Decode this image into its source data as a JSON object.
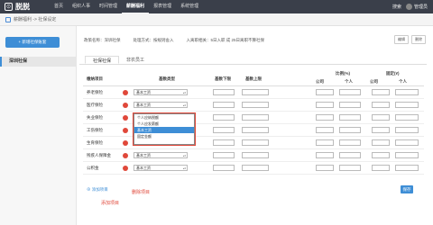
{
  "app": {
    "name": "脱脱",
    "logo_glyph": "⊙"
  },
  "nav": {
    "items": [
      "首页",
      "组织人事",
      "时间管理",
      "薪酬福利",
      "报表管理",
      "系统管理"
    ],
    "active_index": 3,
    "search": "搜索",
    "user": "管理员"
  },
  "breadcrumb": "薪酬福利 -> 社保设定",
  "sidebar": {
    "add_button": "+ 新增社保账套",
    "items": [
      "深圳社保"
    ]
  },
  "info": {
    "policy": "政策名称：深圳社保",
    "method": "处理方式：按规则舍入",
    "rule": "入离职相关：5日入职 成 25日离职不算社保",
    "edit": "编辑",
    "delete": "删除"
  },
  "tabs": [
    "社保社保",
    "非农员工"
  ],
  "table": {
    "headers": {
      "item": "缴纳项目",
      "type": "基数类型",
      "lower": "基数下限",
      "upper": "基数上限",
      "ratio": "比例(%)",
      "ratio_company": "公司",
      "ratio_person": "个人",
      "fixed": "固定(¥)",
      "fixed_company": "公司",
      "fixed_person": "个人"
    },
    "rows": [
      {
        "name": "养老保险",
        "type": "基本工资"
      },
      {
        "name": "医疗保险",
        "type": "基本工资"
      },
      {
        "name": "失业保险",
        "type": "基本工资"
      },
      {
        "name": "工伤保险",
        "type": "基本工资"
      },
      {
        "name": "生育保险",
        "type": "基本工资"
      },
      {
        "name": "残疾人保障金",
        "type": "基本工资"
      },
      {
        "name": "公积金",
        "type": "基本工资"
      }
    ]
  },
  "dropdown": {
    "options": [
      "个人应纳税额",
      "个人应发薪额",
      "基本工资",
      "固定金额"
    ],
    "highlighted": 2
  },
  "add_item": "添加项目",
  "annotation_delete": "删除项目",
  "annotation_add": "添加项目",
  "save": "保存",
  "colors": {
    "accent": "#3e8ed6",
    "danger": "#e0483a",
    "nav_bg": "#3a3f4a"
  }
}
